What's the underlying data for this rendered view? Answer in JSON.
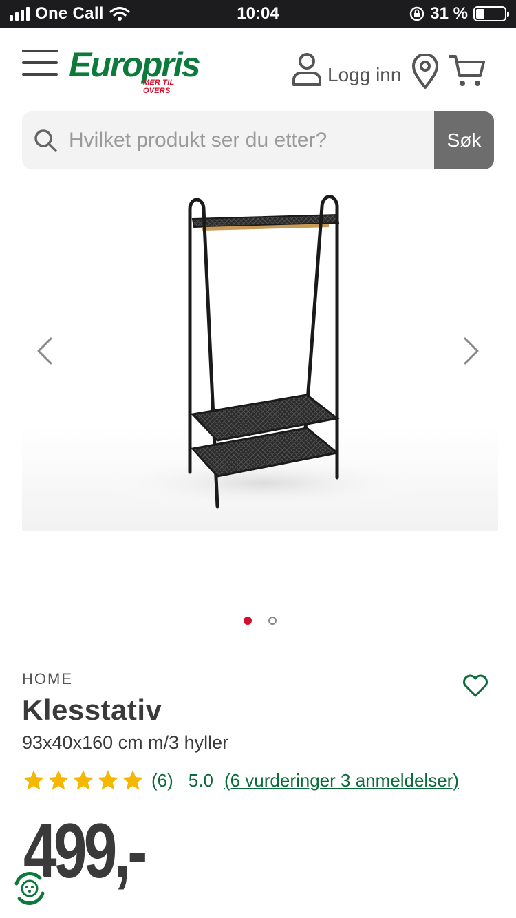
{
  "status_bar": {
    "carrier": "One Call",
    "time": "10:04",
    "battery": "31 %",
    "battery_level": 0.31
  },
  "header": {
    "logo_text": "Europris",
    "logo_tagline": "MER TIL OVERS",
    "login_label": "Logg inn"
  },
  "search": {
    "placeholder": "Hvilket produkt ser du etter?",
    "button_label": "Søk"
  },
  "gallery": {
    "slide_count": 2,
    "active_slide": 1
  },
  "product": {
    "brand": "HOME",
    "title": "Klesstativ",
    "subtitle": "93x40x160 cm m/3 hyller",
    "rating_count": "(6)",
    "rating_score": "5.0",
    "reviews_link": "(6 vurderinger 3 anmeldelser)",
    "stars": 5,
    "price": "499,-"
  },
  "colors": {
    "brand_green": "#0b7a3b",
    "brand_red": "#d2102e",
    "star": "#f5b800",
    "link": "#0b6b3a"
  },
  "icons": [
    "menu-icon",
    "user-icon",
    "location-icon",
    "cart-icon",
    "search-icon",
    "chevron-left-icon",
    "chevron-right-icon",
    "heart-icon",
    "star-icon",
    "eco-icon"
  ]
}
